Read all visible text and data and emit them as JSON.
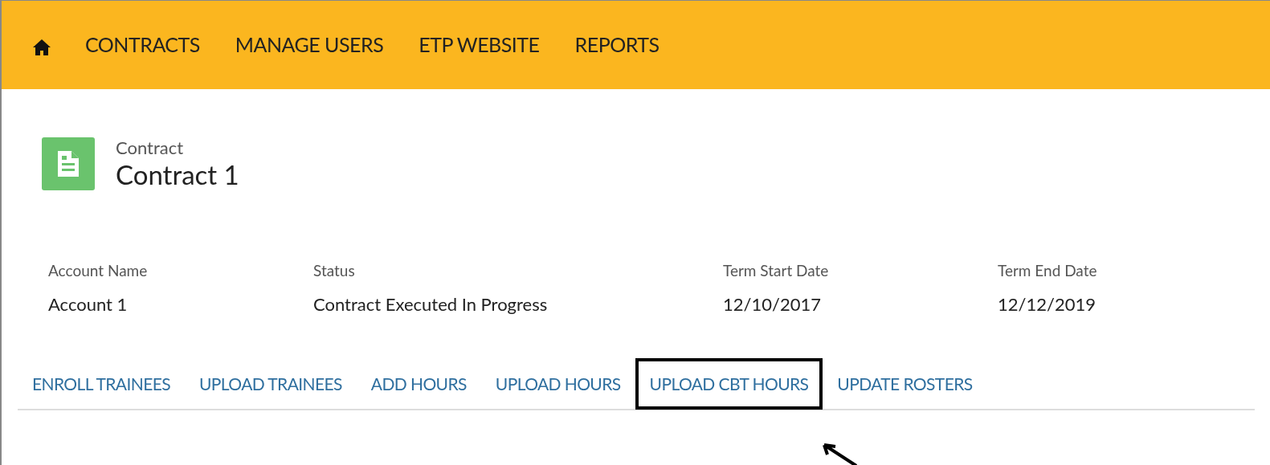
{
  "nav": {
    "items": [
      "CONTRACTS",
      "MANAGE USERS",
      "ETP WEBSITE",
      "REPORTS"
    ]
  },
  "record": {
    "type": "Contract",
    "name": "Contract 1"
  },
  "fields": [
    {
      "label": "Account Name",
      "value": "Account 1"
    },
    {
      "label": "Status",
      "value": "Contract Executed In Progress"
    },
    {
      "label": "Term Start Date",
      "value": "12/10/2017"
    },
    {
      "label": "Term End Date",
      "value": "12/12/2019"
    }
  ],
  "actions": [
    {
      "label": "ENROLL TRAINEES",
      "highlighted": false
    },
    {
      "label": "UPLOAD TRAINEES",
      "highlighted": false
    },
    {
      "label": "ADD HOURS",
      "highlighted": false
    },
    {
      "label": "UPLOAD HOURS",
      "highlighted": false
    },
    {
      "label": "UPLOAD CBT HOURS",
      "highlighted": true
    },
    {
      "label": "UPDATE ROSTERS",
      "highlighted": false
    }
  ]
}
